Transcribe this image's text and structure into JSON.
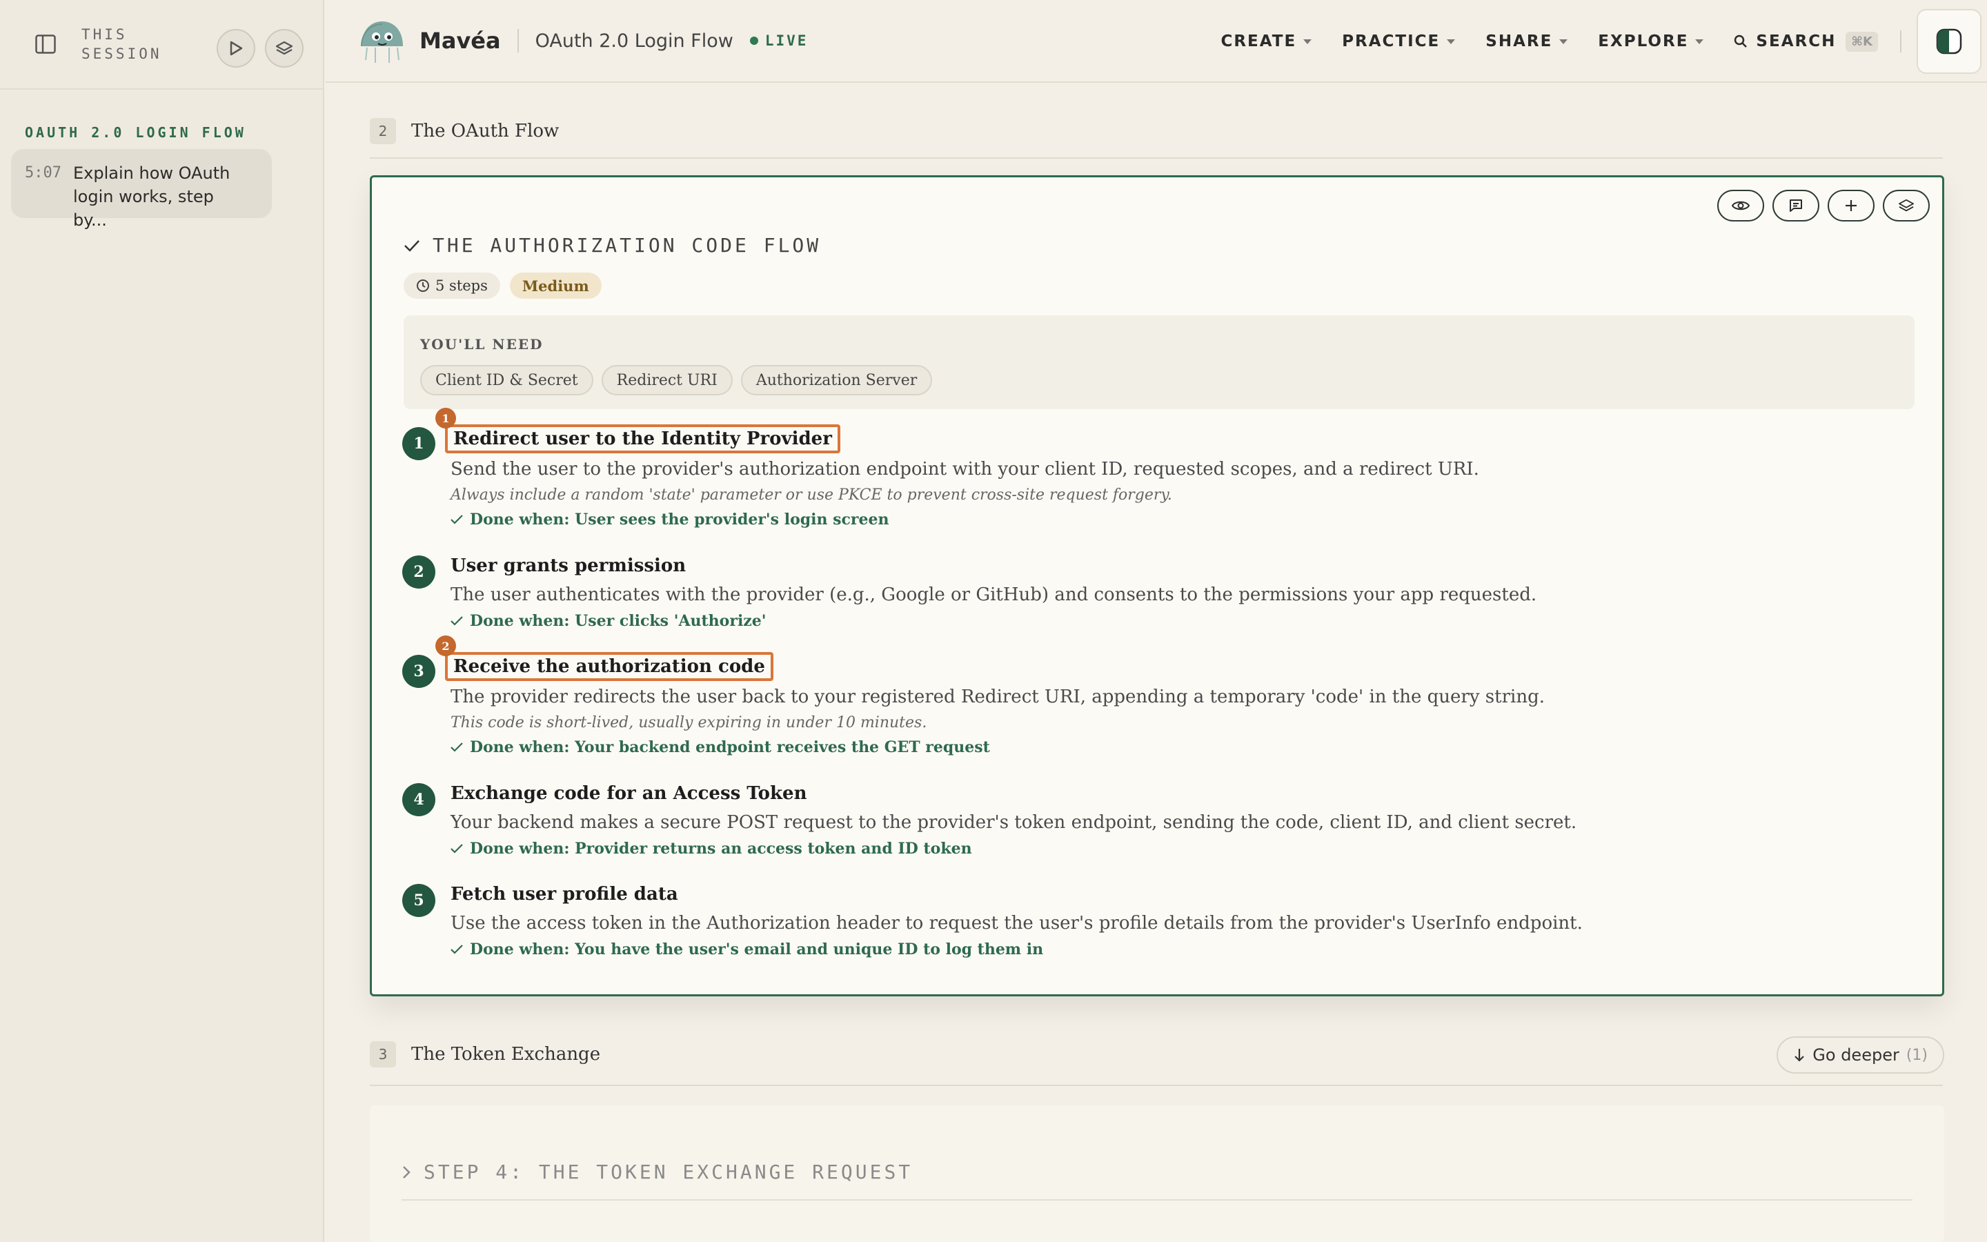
{
  "sidebar": {
    "session_label": "THIS SESSION",
    "section_heading": "OAUTH 2.0 LOGIN FLOW",
    "items": [
      {
        "time": "5:07",
        "text": "Explain how OAuth login works, step by..."
      }
    ]
  },
  "header": {
    "brand": "Mavéa",
    "title": "OAuth 2.0 Login Flow",
    "live": "LIVE",
    "nav": [
      {
        "label": "CREATE"
      },
      {
        "label": "PRACTICE"
      },
      {
        "label": "SHARE"
      },
      {
        "label": "EXPLORE"
      }
    ],
    "search": {
      "label": "SEARCH",
      "shortcut": "⌘K"
    }
  },
  "sections": [
    {
      "num": "2",
      "title": "The OAuth Flow"
    },
    {
      "num": "3",
      "title": "The Token Exchange"
    }
  ],
  "card": {
    "title": "THE AUTHORIZATION CODE FLOW",
    "steps_badge": "5 steps",
    "difficulty": "Medium",
    "needs_label": "YOU'LL NEED",
    "needs": [
      "Client ID & Secret",
      "Redirect URI",
      "Authorization Server"
    ],
    "steps": [
      {
        "num": "1",
        "title": "Redirect user to the Identity Provider",
        "desc": "Send the user to the provider's authorization endpoint with your client ID, requested scopes, and a redirect URI.",
        "note": "Always include a random 'state' parameter or use PKCE to prevent cross-site request forgery.",
        "done": "Done when: User sees the provider's login screen",
        "highlight": "1"
      },
      {
        "num": "2",
        "title": "User grants permission",
        "desc": "The user authenticates with the provider (e.g., Google or GitHub) and consents to the permissions your app requested.",
        "note": "",
        "done": "Done when: User clicks 'Authorize'",
        "highlight": ""
      },
      {
        "num": "3",
        "title": "Receive the authorization code",
        "desc": "The provider redirects the user back to your registered Redirect URI, appending a temporary 'code' in the query string.",
        "note": "This code is short-lived, usually expiring in under 10 minutes.",
        "done": "Done when: Your backend endpoint receives the GET request",
        "highlight": "2"
      },
      {
        "num": "4",
        "title": "Exchange code for an Access Token",
        "desc": "Your backend makes a secure POST request to the provider's token endpoint, sending the code, client ID, and client secret.",
        "note": "",
        "done": "Done when: Provider returns an access token and ID token",
        "highlight": ""
      },
      {
        "num": "5",
        "title": "Fetch user profile data",
        "desc": "Use the access token in the Authorization header to request the user's profile details from the provider's UserInfo endpoint.",
        "note": "",
        "done": "Done when: You have the user's email and unique ID to log them in",
        "highlight": ""
      }
    ]
  },
  "go_deeper": {
    "label": "Go deeper",
    "count": "(1)"
  },
  "next_card": {
    "title": "STEP 4: THE TOKEN EXCHANGE REQUEST"
  },
  "colors": {
    "accent": "#2e6a4d",
    "highlight": "#d9763a",
    "background": "#f3efe6"
  }
}
